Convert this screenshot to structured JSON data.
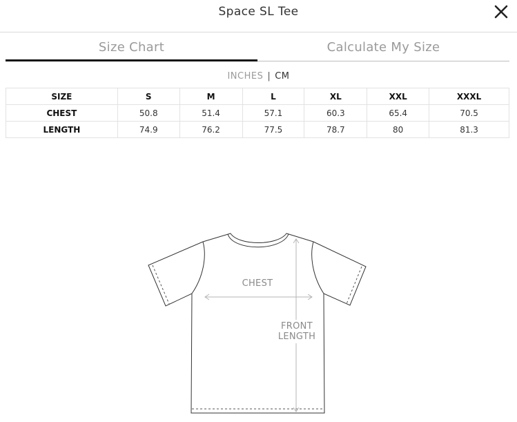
{
  "header": {
    "title": "Space SL Tee",
    "close_icon": "close-icon"
  },
  "tabs": [
    {
      "label": "Size Chart",
      "active": true
    },
    {
      "label": "Calculate My Size",
      "active": false
    }
  ],
  "units": {
    "inches": "INCHES",
    "separator": "|",
    "cm": "CM",
    "selected": "CM"
  },
  "table": {
    "headers": [
      "SIZE",
      "S",
      "M",
      "L",
      "XL",
      "XXL",
      "XXXL"
    ],
    "rows": [
      {
        "label": "CHEST",
        "values": [
          "50.8",
          "51.4",
          "57.1",
          "60.3",
          "65.4",
          "70.5"
        ]
      },
      {
        "label": "LENGTH",
        "values": [
          "74.9",
          "76.2",
          "77.5",
          "78.7",
          "80",
          "81.3"
        ]
      }
    ]
  },
  "diagram": {
    "chest_label": "CHEST",
    "front_label_line1": "FRONT",
    "front_label_line2": "LENGTH"
  }
}
